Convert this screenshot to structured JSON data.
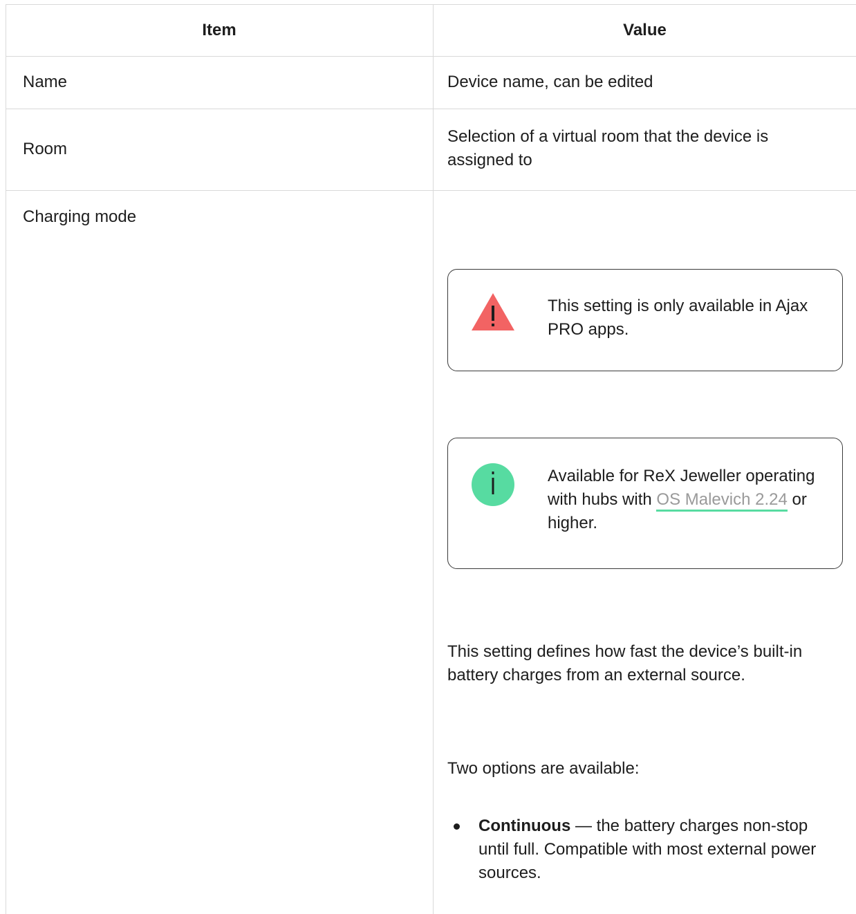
{
  "table": {
    "headers": [
      "Item",
      "Value"
    ],
    "rows": [
      {
        "item": "Name",
        "value": "Device name, can be edited"
      },
      {
        "item": "Room",
        "value": "Selection of a virtual room that the device is assigned to"
      },
      {
        "item": "Charging mode"
      }
    ]
  },
  "warning_callout": {
    "icon": "warning-triangle-icon",
    "icon_color": "#f26363",
    "text": "This setting is only available in Ajax PRO apps."
  },
  "info_callout": {
    "icon": "info-circle-icon",
    "icon_color": "#57dba1",
    "text_before": "Available for ReX Jeweller operating with hubs with ",
    "link_text": "OS Malevich 2.24",
    "text_after": " or higher."
  },
  "description": "This setting defines how fast the device’s built-in battery charges from an external source.",
  "options_intro": "Two options are available:",
  "options": [
    {
      "name": "Continuous",
      "separator": " — ",
      "description": "the battery charges non-stop until full. Compatible with most external power sources."
    }
  ],
  "colors": {
    "border": "#d9d9d9",
    "link_underline": "#57dba1",
    "link_text": "#9a9a9a"
  }
}
